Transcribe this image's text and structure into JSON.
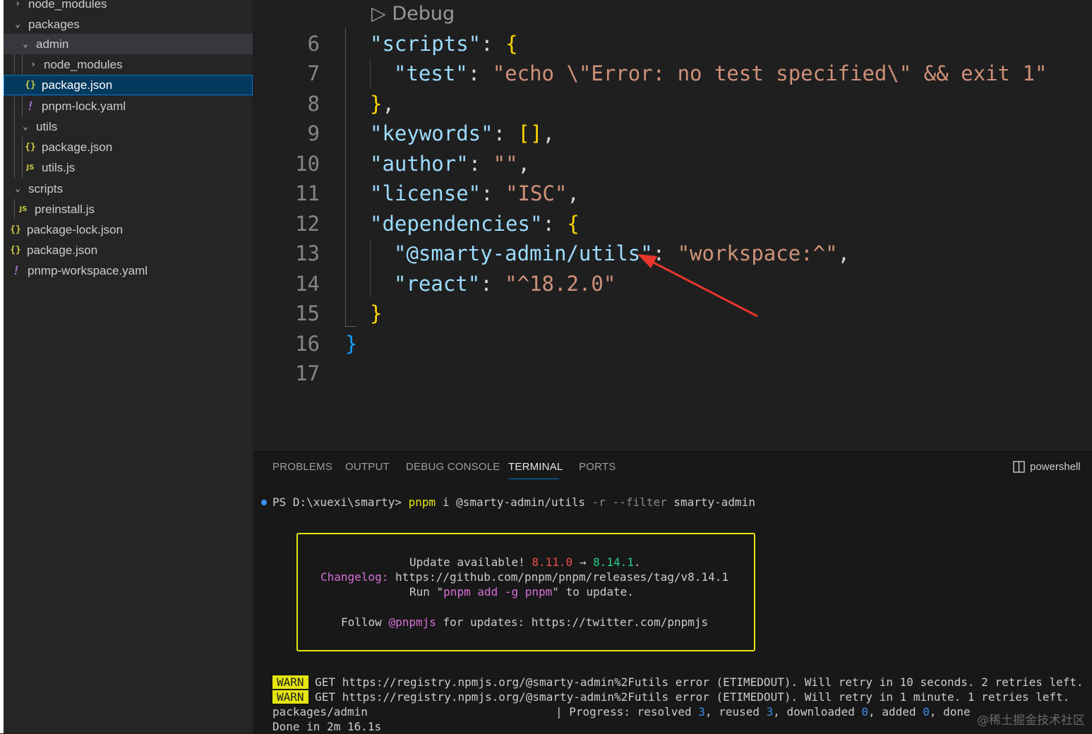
{
  "explorer": {
    "items": [
      {
        "label": "node_modules",
        "kind": "folder-collapsed"
      },
      {
        "label": "packages",
        "kind": "folder-open"
      },
      {
        "label": "admin",
        "kind": "folder-open"
      },
      {
        "label": "node_modules",
        "kind": "folder-collapsed"
      },
      {
        "label": "package.json",
        "kind": "json"
      },
      {
        "label": "pnpm-lock.yaml",
        "kind": "yaml"
      },
      {
        "label": "utils",
        "kind": "folder-open"
      },
      {
        "label": "package.json",
        "kind": "json"
      },
      {
        "label": "utils.js",
        "kind": "js"
      },
      {
        "label": "scripts",
        "kind": "folder-open"
      },
      {
        "label": "preinstall.js",
        "kind": "js"
      },
      {
        "label": "package-lock.json",
        "kind": "json"
      },
      {
        "label": "package.json",
        "kind": "json"
      },
      {
        "label": "pnmp-workspace.yaml",
        "kind": "yaml"
      }
    ],
    "icons": {
      "chevron_right": "›",
      "chevron_down": "⌄",
      "json": "{}",
      "yaml": "!",
      "js": "JS"
    }
  },
  "editor": {
    "codelens": "▷ Debug",
    "line_numbers": [
      "6",
      "7",
      "8",
      "9",
      "10",
      "11",
      "12",
      "13",
      "14",
      "15",
      "16",
      "17"
    ],
    "tokens": {
      "scripts_key": "\"scripts\"",
      "test_key": "\"test\"",
      "test_val": "\"echo \\\"Error: no test specified\\\" && exit 1\"",
      "keywords_key": "\"keywords\"",
      "author_key": "\"author\"",
      "author_val": "\"\"",
      "license_key": "\"license\"",
      "license_val": "\"ISC\"",
      "dependencies_key": "\"dependencies\"",
      "dep1_key": "\"@smarty-admin/utils\"",
      "dep1_val": "\"workspace:^\"",
      "dep2_key": "\"react\"",
      "dep2_val": "\"^18.2.0\"",
      "colon": ": ",
      "comma": ",",
      "brace_open": "{",
      "brace_close": "}",
      "brace_close_comma": "},",
      "empty_array": "[]"
    },
    "annotation_color": "#e8362c"
  },
  "panel": {
    "tabs": [
      "PROBLEMS",
      "OUTPUT",
      "DEBUG CONSOLE",
      "TERMINAL",
      "PORTS"
    ],
    "active_tab": "TERMINAL",
    "shell_label": "powershell",
    "terminal": {
      "prompt": "PS D:\\xuexi\\smarty> ",
      "cmd": "pnpm",
      "args1": " i @smarty-admin/utils ",
      "flag": "-r --filter",
      "args2": " smarty-admin",
      "update_prefix": "Update available! ",
      "old_version": "8.11.0",
      "arrow": " → ",
      "new_version": "8.14.1",
      "update_suffix": ".",
      "changelog_label": "Changelog:",
      "changelog_url": " https://github.com/pnpm/pnpm/releases/tag/v8.14.1",
      "run_prefix": "Run \"",
      "run_cmd": "pnpm add -g pnpm",
      "run_suffix": "\" to update.",
      "follow_prefix": "Follow ",
      "follow_handle": "@pnpmjs",
      "follow_suffix": " for updates: https://twitter.com/pnpmjs",
      "warn_badge": "WARN",
      "warn1": " GET https://registry.npmjs.org/@smarty-admin%2Futils error (ETIMEDOUT). Will retry in 10 seconds. 2 retries left.",
      "warn2": " GET https://registry.npmjs.org/@smarty-admin%2Futils error (ETIMEDOUT). Will retry in 1 minute. 1 retries left.",
      "progress_path": "packages/admin",
      "progress_label": "| Progress: resolved ",
      "resolved": "3",
      "reused_label": ", reused ",
      "reused": "3",
      "downloaded_label": ", downloaded ",
      "downloaded": "0",
      "added_label": ", added ",
      "added": "0",
      "done_label": ", done",
      "done_line": "Done in 2m 16.1s"
    }
  },
  "watermark": "@稀土掘金技术社区"
}
